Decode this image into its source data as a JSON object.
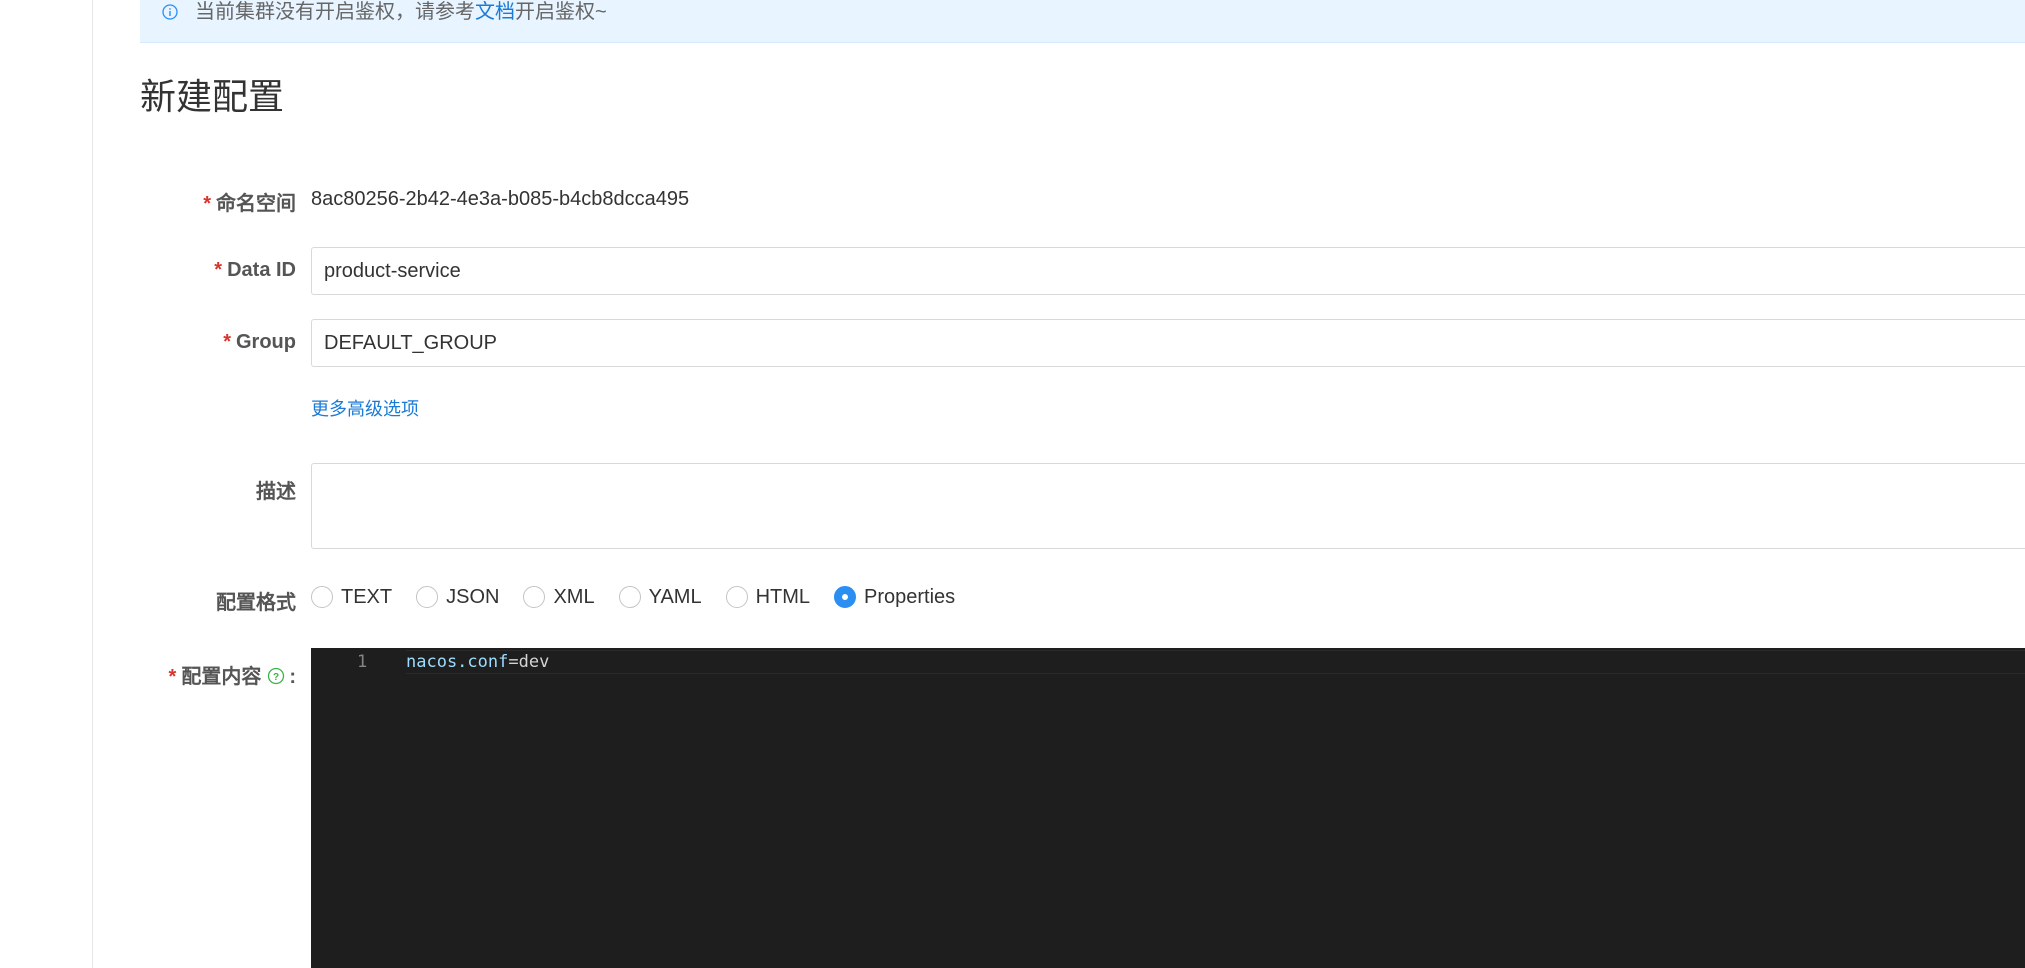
{
  "notice": {
    "text_before": "当前集群没有开启鉴权，请参考",
    "link": "文档",
    "text_after": "开启鉴权~"
  },
  "page_title": "新建配置",
  "form": {
    "required_mark": "*",
    "namespace": {
      "label": "命名空间",
      "value": "8ac80256-2b42-4e3a-b085-b4cb8dcca495"
    },
    "data_id": {
      "label": "Data ID",
      "value": "product-service"
    },
    "group": {
      "label": "Group",
      "value": "DEFAULT_GROUP"
    },
    "more_options": "更多高级选项",
    "description": {
      "label": "描述",
      "value": ""
    },
    "format": {
      "label": "配置格式",
      "options": [
        "TEXT",
        "JSON",
        "XML",
        "YAML",
        "HTML",
        "Properties"
      ],
      "selected": "Properties"
    },
    "content": {
      "label": "配置内容",
      "colon": ":",
      "lines": [
        {
          "number": "1",
          "key": "nacos.conf",
          "eq": "=",
          "value": "dev"
        }
      ]
    }
  },
  "colors": {
    "accent": "#2a8ef3",
    "link": "#1a7bd6",
    "required": "#d9342b",
    "notice_bg": "#e8f4ff",
    "editor_bg": "#1e1e1e",
    "help_icon": "#3bb346"
  },
  "icons": {
    "notice": "info-circle-icon",
    "help": "question-circle-icon"
  }
}
